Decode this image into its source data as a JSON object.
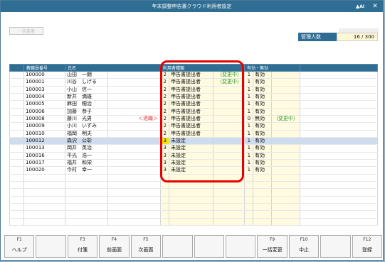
{
  "window": {
    "title": "年末調整申告書クラウド利用者設定",
    "logo_text": "AI",
    "close_label": "✕"
  },
  "toolbar": {
    "bulk_change_label": "一括変更"
  },
  "user_count": {
    "label": "管理人数",
    "value": "16 / 300"
  },
  "table": {
    "headers": [
      "教職員番号",
      "氏名",
      "",
      "利用者種類",
      "",
      "有効・無効"
    ],
    "rows": [
      {
        "id": "100000",
        "name": "山田　一朗",
        "note": "",
        "code": "2",
        "type": "申告書提出者",
        "status": "（変更中）",
        "valid_code": "1",
        "valid": "有効"
      },
      {
        "id": "100001",
        "name": "川谷　しげる",
        "note": "",
        "code": "2",
        "type": "申告書提出者",
        "status": "（変更中）",
        "valid_code": "1",
        "valid": "有効"
      },
      {
        "id": "100003",
        "name": "小山　信一",
        "note": "",
        "code": "2",
        "type": "申告書提出者",
        "status": "",
        "valid_code": "1",
        "valid": "有効"
      },
      {
        "id": "100004",
        "name": "新井　満雄",
        "note": "",
        "code": "2",
        "type": "申告書提出者",
        "status": "",
        "valid_code": "1",
        "valid": "有効"
      },
      {
        "id": "100005",
        "name": "麻田　穂治",
        "note": "",
        "code": "2",
        "type": "申告書提出者",
        "status": "",
        "valid_code": "1",
        "valid": "有効"
      },
      {
        "id": "100006",
        "name": "加藤　恭子",
        "note": "",
        "code": "2",
        "type": "申告書提出者",
        "status": "",
        "valid_code": "1",
        "valid": "有効"
      },
      {
        "id": "100008",
        "name": "藤川　光男",
        "note": "＜退職＞",
        "code": "2",
        "type": "申告書提出者",
        "status": "",
        "valid_code": "0",
        "valid": "無効",
        "valid_status": "（変更中）"
      },
      {
        "id": "100009",
        "name": "小川　いずみ",
        "note": "",
        "code": "2",
        "type": "申告書提出者",
        "status": "",
        "valid_code": "1",
        "valid": "有効"
      },
      {
        "id": "100010",
        "name": "福岡　明夫",
        "note": "",
        "code": "2",
        "type": "申告書提出者",
        "status": "",
        "valid_code": "1",
        "valid": "有効"
      },
      {
        "id": "100012",
        "name": "森沢　公彰",
        "note": "",
        "code": "3",
        "type": "未設定",
        "status": "",
        "valid_code": "1",
        "valid": "有効",
        "selected": true
      },
      {
        "id": "100013",
        "name": "岡井　英治",
        "note": "",
        "code": "3",
        "type": "未設定",
        "status": "",
        "valid_code": "1",
        "valid": "有効"
      },
      {
        "id": "100016",
        "name": "平光　浩一",
        "note": "",
        "code": "3",
        "type": "未設定",
        "status": "",
        "valid_code": "1",
        "valid": "有効"
      },
      {
        "id": "100017",
        "name": "福井　和栄",
        "note": "",
        "code": "3",
        "type": "未設定",
        "status": "",
        "valid_code": "1",
        "valid": "有効"
      },
      {
        "id": "100020",
        "name": "今村　幸一",
        "note": "",
        "code": "3",
        "type": "未設定",
        "status": "",
        "valid_code": "1",
        "valid": "有効"
      }
    ]
  },
  "fkeys": [
    {
      "key": "F1",
      "label": "ヘルプ"
    },
    {
      "key": "",
      "label": ""
    },
    {
      "key": "F3",
      "label": "付箋"
    },
    {
      "key": "F4",
      "label": "前画面"
    },
    {
      "key": "F5",
      "label": "次画面"
    },
    {
      "key": "",
      "label": ""
    },
    {
      "key": "",
      "label": ""
    },
    {
      "key": "",
      "label": ""
    },
    {
      "key": "F9",
      "label": "一括変更"
    },
    {
      "key": "F10",
      "label": "中止"
    },
    {
      "key": "",
      "label": ""
    },
    {
      "key": "F12",
      "label": "登録"
    }
  ]
}
